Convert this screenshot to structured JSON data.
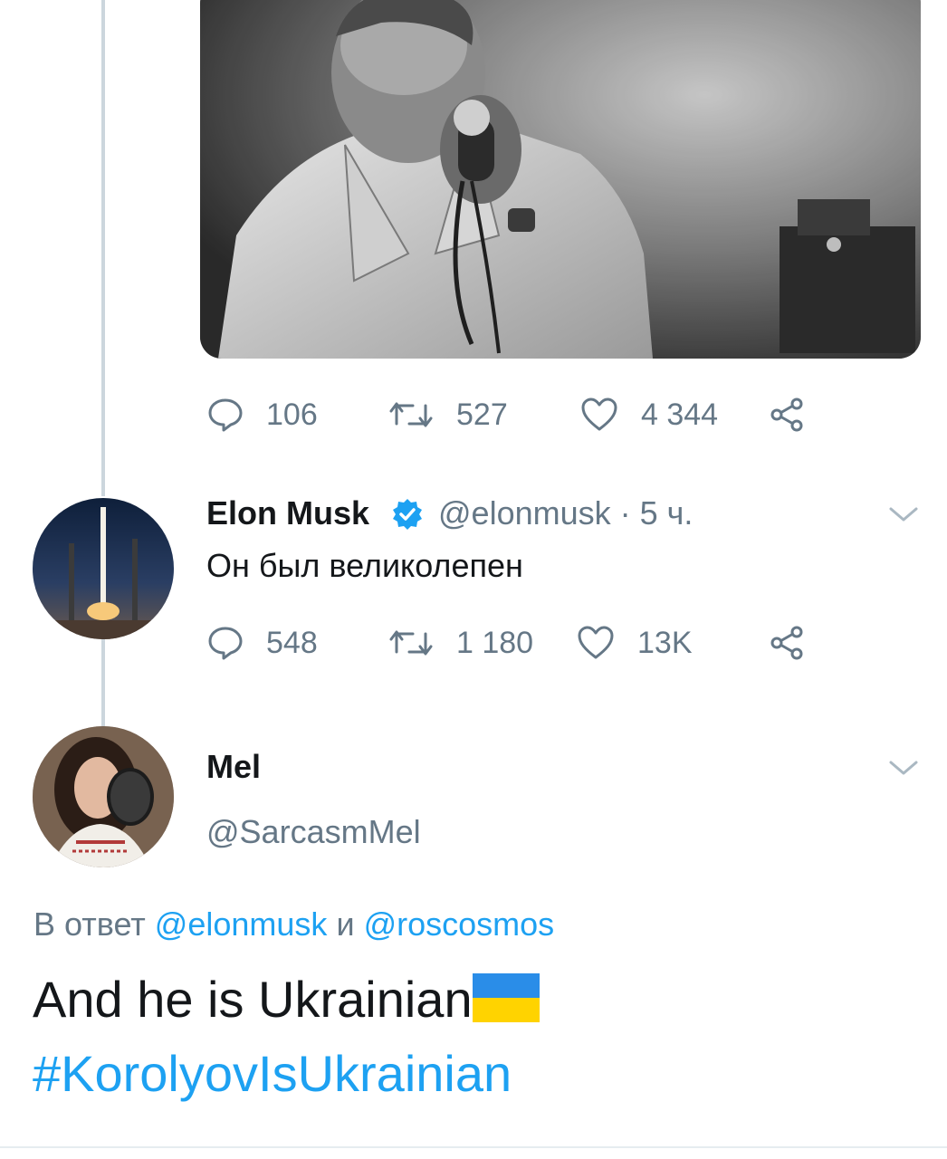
{
  "first_tweet": {
    "photo_label": "",
    "actions": {
      "replies": "106",
      "retweets": "527",
      "likes": "4 344"
    }
  },
  "elon_reply": {
    "name": "Elon Musk",
    "handle": "@elonmusk",
    "time": "· 5 ч.",
    "text": "Он был великолепен",
    "actions": {
      "replies": "548",
      "retweets": "1 180",
      "likes": "13K"
    }
  },
  "mel_tweet": {
    "name": "Mel",
    "handle": "@SarcasmMel",
    "reply_prefix": "В ответ",
    "reply_user1": "@elonmusk",
    "reply_and": "и",
    "reply_user2": "@roscosmos",
    "text": "And he is Ukrainian",
    "hashtag": "#KorolyovIsUkrainian"
  },
  "colors": {
    "link": "#1da1f2",
    "secondary": "#657786",
    "verified": "#1da1f2",
    "thread_line": "#ccd6dd"
  },
  "icons": {
    "reply": "reply-icon",
    "retweet": "retweet-icon",
    "like": "heart-icon",
    "share": "share-icon",
    "verified": "verified-badge-icon",
    "menu": "chevron-down-icon",
    "flag": "ukraine-flag-icon"
  }
}
